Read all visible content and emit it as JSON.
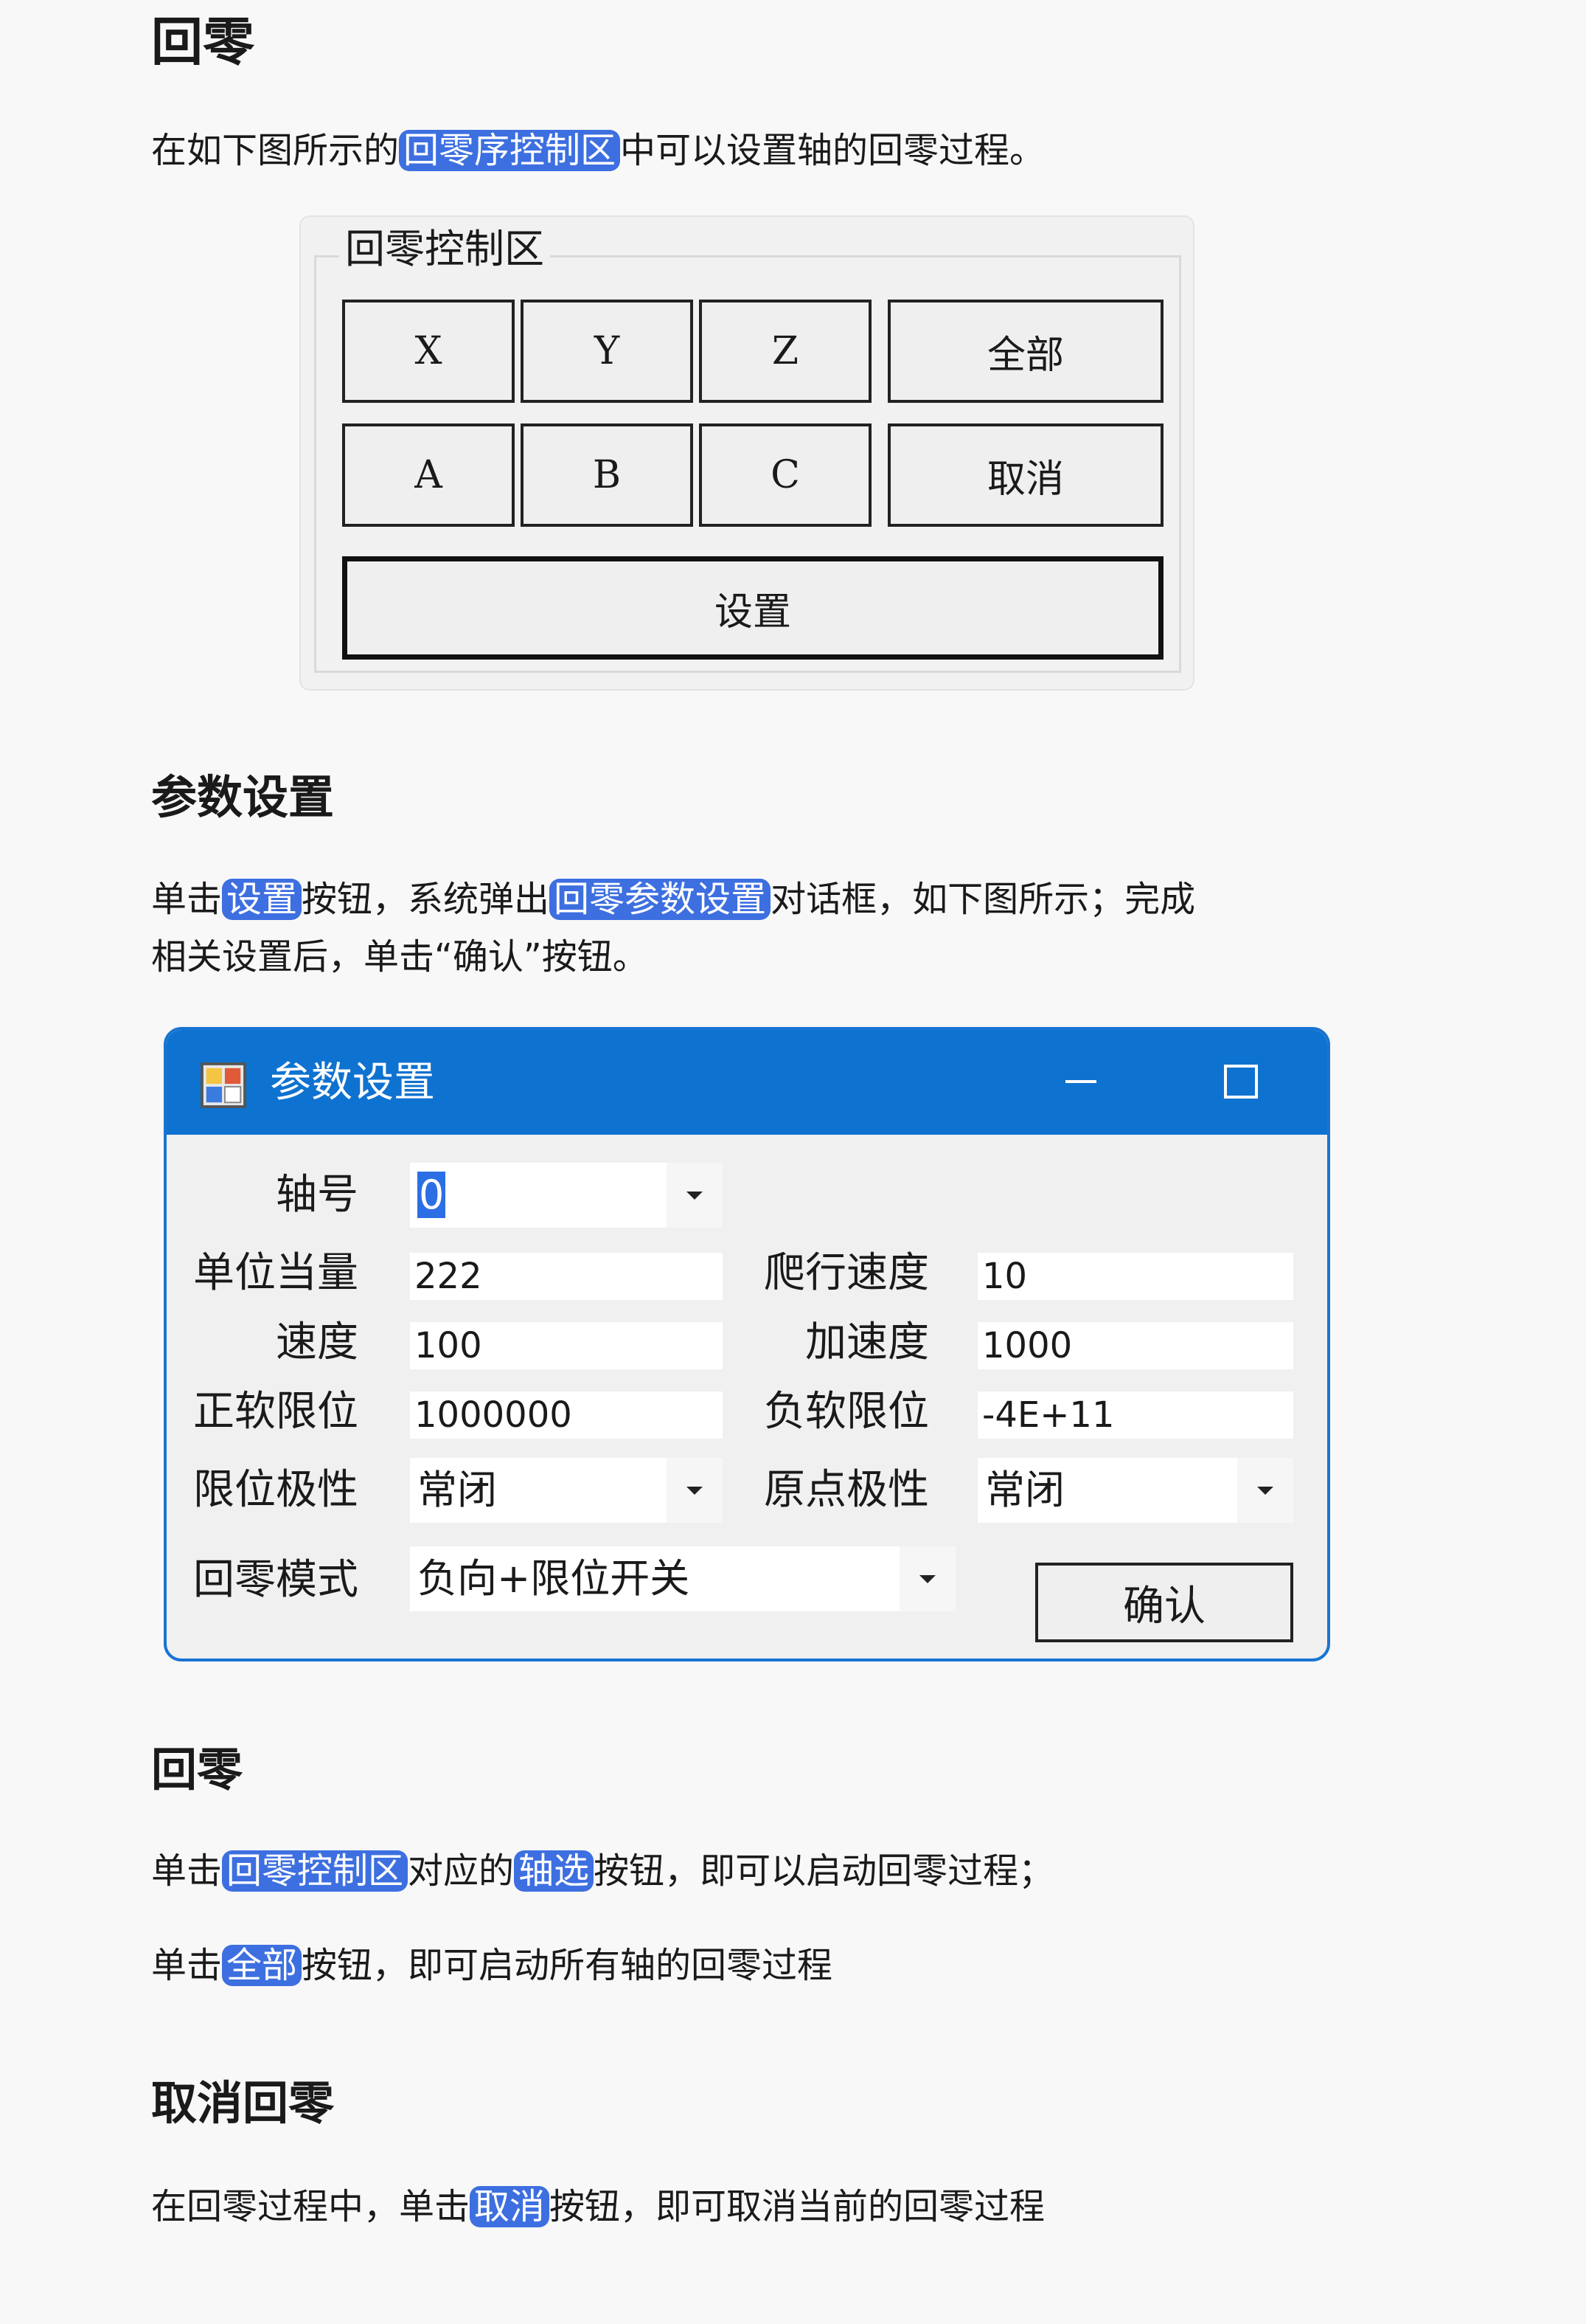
{
  "sections": {
    "s1_title": "回零",
    "s1_text_a": "在如下图所示的",
    "s1_text_hl": "回零序控制区",
    "s1_text_b": "中可以设置轴的回零过程。",
    "s2_title": "参数设置",
    "s2_line1_a": "单击",
    "s2_line1_hl1": "设置",
    "s2_line1_b": "按钮，系统弹出",
    "s2_line1_hl2": "回零参数设置",
    "s2_line1_c": "对话框，如下图所示；完成",
    "s2_line2": "相关设置后，单击“确认”按钮。",
    "s3_title": "回零",
    "s3_p1_a": "单击",
    "s3_p1_hl1": "回零控制区",
    "s3_p1_b": "对应的",
    "s3_p1_hl2": "轴选",
    "s3_p1_c": "按钮，即可以启动回零过程；",
    "s3_p2_a": "单击",
    "s3_p2_hl": "全部",
    "s3_p2_b": "按钮，即可启动所有轴的回零过程",
    "s4_title": "取消回零",
    "s4_p_a": "在回零过程中，单击",
    "s4_p_hl": "取消",
    "s4_p_b": "按钮，即可取消当前的回零过程"
  },
  "control_group": {
    "title": "回零控制区",
    "buttons": {
      "x": "X",
      "y": "Y",
      "z": "Z",
      "all": "全部",
      "a": "A",
      "b": "B",
      "c": "C",
      "cancel": "取消",
      "settings": "设置"
    }
  },
  "dialog": {
    "title": "参数设置",
    "axis_label": "轴号",
    "axis_value": "0",
    "unit_label": "单位当量",
    "unit_value": "222",
    "creep_label": "爬行速度",
    "creep_value": "10",
    "speed_label": "速度",
    "speed_value": "100",
    "accel_label": "加速度",
    "accel_value": "1000",
    "pos_limit_label": "正软限位",
    "pos_limit_value": "1000000",
    "neg_limit_label": "负软限位",
    "neg_limit_value": "-4E+11",
    "limit_polarity_label": "限位极性",
    "limit_polarity_value": "常闭",
    "origin_polarity_label": "原点极性",
    "origin_polarity_value": "常闭",
    "home_mode_label": "回零模式",
    "home_mode_value": "负向+限位开关",
    "confirm": "确认"
  },
  "colors": {
    "highlight": "#3d6fe0",
    "titlebar": "#0e72d0"
  }
}
